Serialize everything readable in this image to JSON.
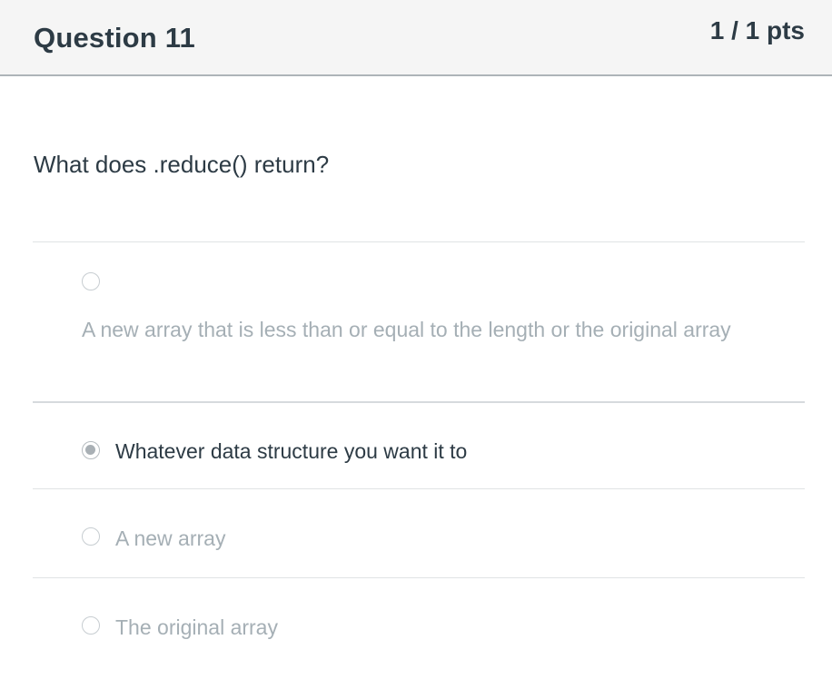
{
  "header": {
    "title": "Question 11",
    "points": "1 / 1 pts"
  },
  "question": {
    "text": "What does .reduce() return?"
  },
  "answers": [
    {
      "text": "A new array that is less than or equal to the length or the original array",
      "selected": false
    },
    {
      "text": "Whatever data structure you want it to",
      "selected": true
    },
    {
      "text": "A new array",
      "selected": false
    },
    {
      "text": "The original array",
      "selected": false
    }
  ],
  "colors": {
    "header_bg": "#f5f5f5",
    "text_primary": "#2d3b45",
    "text_muted": "#a5afb5",
    "radio_selected": "#a9b0b5"
  }
}
